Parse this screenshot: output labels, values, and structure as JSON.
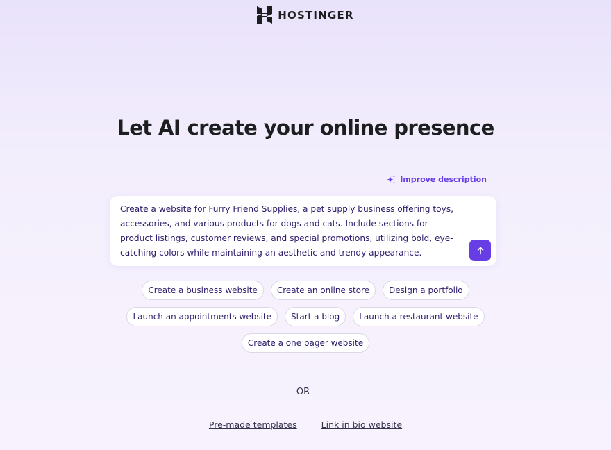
{
  "brand": {
    "name": "HOSTINGER",
    "logo_icon": "hostinger-logo-icon"
  },
  "hero": {
    "title": "Let AI create your online presence"
  },
  "improve": {
    "label": "Improve description",
    "icon": "sparkle-icon",
    "color": "#673de6"
  },
  "prompt": {
    "value": "Create a website for Furry Friend Supplies, a pet supply business offering toys, accessories, and various products for dogs and cats. Include sections for product listings, customer reviews, and special promotions, utilizing bold, eye-catching colors while maintaining an aesthetic and trendy appearance.",
    "send_icon": "arrow-up-icon",
    "accent": "#673de6"
  },
  "suggestions": {
    "row1": [
      "Create a business website",
      "Create an online store",
      "Design a portfolio"
    ],
    "row2": [
      "Launch an appointments website",
      "Start a blog",
      "Launch a restaurant website"
    ],
    "row3": [
      "Create a one pager website"
    ]
  },
  "divider": {
    "label": "OR"
  },
  "links": {
    "templates": "Pre-made templates",
    "bio": "Link in bio website"
  }
}
